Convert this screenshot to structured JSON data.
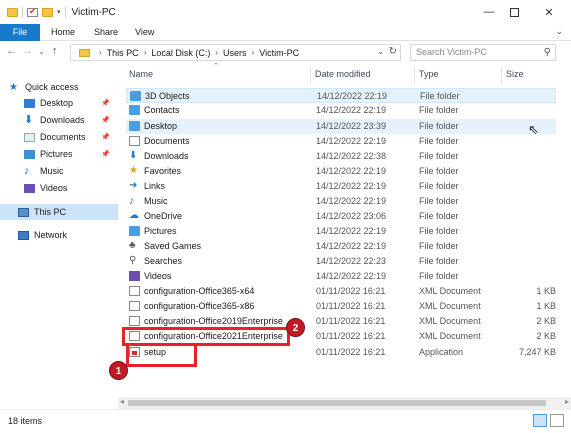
{
  "window": {
    "title": "Victim-PC"
  },
  "ribbon": {
    "tabs": [
      "File",
      "Home",
      "Share",
      "View"
    ]
  },
  "address": {
    "crumbs": [
      "This PC",
      "Local Disk (C:)",
      "Users",
      "Victim-PC"
    ]
  },
  "search": {
    "placeholder": "Search Victim-PC"
  },
  "nav": {
    "items": [
      {
        "label": "Quick access",
        "icon": "star-icon",
        "pinned": false
      },
      {
        "label": "Desktop",
        "icon": "desktop-icon",
        "pinned": true
      },
      {
        "label": "Downloads",
        "icon": "download-icon",
        "pinned": true
      },
      {
        "label": "Documents",
        "icon": "documents-icon",
        "pinned": true
      },
      {
        "label": "Pictures",
        "icon": "pictures-icon",
        "pinned": true
      },
      {
        "label": "Music",
        "icon": "music-icon",
        "pinned": false
      },
      {
        "label": "Videos",
        "icon": "videos-icon",
        "pinned": false
      },
      {
        "label": "This PC",
        "icon": "computer-icon",
        "pinned": false
      },
      {
        "label": "Network",
        "icon": "network-icon",
        "pinned": false
      }
    ]
  },
  "columns": {
    "name": "Name",
    "date": "Date modified",
    "type": "Type",
    "size": "Size"
  },
  "files": [
    {
      "name": "3D Objects",
      "date": "14/12/2022 22:19",
      "type": "File folder",
      "size": ""
    },
    {
      "name": "Contacts",
      "date": "14/12/2022 22:19",
      "type": "File folder",
      "size": ""
    },
    {
      "name": "Desktop",
      "date": "14/12/2022 23:39",
      "type": "File folder",
      "size": ""
    },
    {
      "name": "Documents",
      "date": "14/12/2022 22:19",
      "type": "File folder",
      "size": ""
    },
    {
      "name": "Downloads",
      "date": "14/12/2022 22:38",
      "type": "File folder",
      "size": ""
    },
    {
      "name": "Favorites",
      "date": "14/12/2022 22:19",
      "type": "File folder",
      "size": ""
    },
    {
      "name": "Links",
      "date": "14/12/2022 22:19",
      "type": "File folder",
      "size": ""
    },
    {
      "name": "Music",
      "date": "14/12/2022 22:19",
      "type": "File folder",
      "size": ""
    },
    {
      "name": "OneDrive",
      "date": "14/12/2022 23:06",
      "type": "File folder",
      "size": ""
    },
    {
      "name": "Pictures",
      "date": "14/12/2022 22:19",
      "type": "File folder",
      "size": ""
    },
    {
      "name": "Saved Games",
      "date": "14/12/2022 22:19",
      "type": "File folder",
      "size": ""
    },
    {
      "name": "Searches",
      "date": "14/12/2022 22:23",
      "type": "File folder",
      "size": ""
    },
    {
      "name": "Videos",
      "date": "14/12/2022 22:19",
      "type": "File folder",
      "size": ""
    },
    {
      "name": "configuration-Office365-x64",
      "date": "01/11/2022 16:21",
      "type": "XML Document",
      "size": "1 KB"
    },
    {
      "name": "configuration-Office365-x86",
      "date": "01/11/2022 16:21",
      "type": "XML Document",
      "size": "1 KB"
    },
    {
      "name": "configuration-Office2019Enterprise",
      "date": "01/11/2022 16:21",
      "type": "XML Document",
      "size": "2 KB"
    },
    {
      "name": "configuration-Office2021Enterprise",
      "date": "01/11/2022 16:21",
      "type": "XML Document",
      "size": "2 KB"
    },
    {
      "name": "setup",
      "date": "01/11/2022 16:21",
      "type": "Application",
      "size": "7,247 KB"
    }
  ],
  "annotations": [
    {
      "label": "1"
    },
    {
      "label": "2"
    }
  ],
  "status": {
    "count": "18 items"
  },
  "colors": {
    "accent": "#1979ca",
    "highlight": "#e8212a",
    "badge": "#c21a24"
  }
}
